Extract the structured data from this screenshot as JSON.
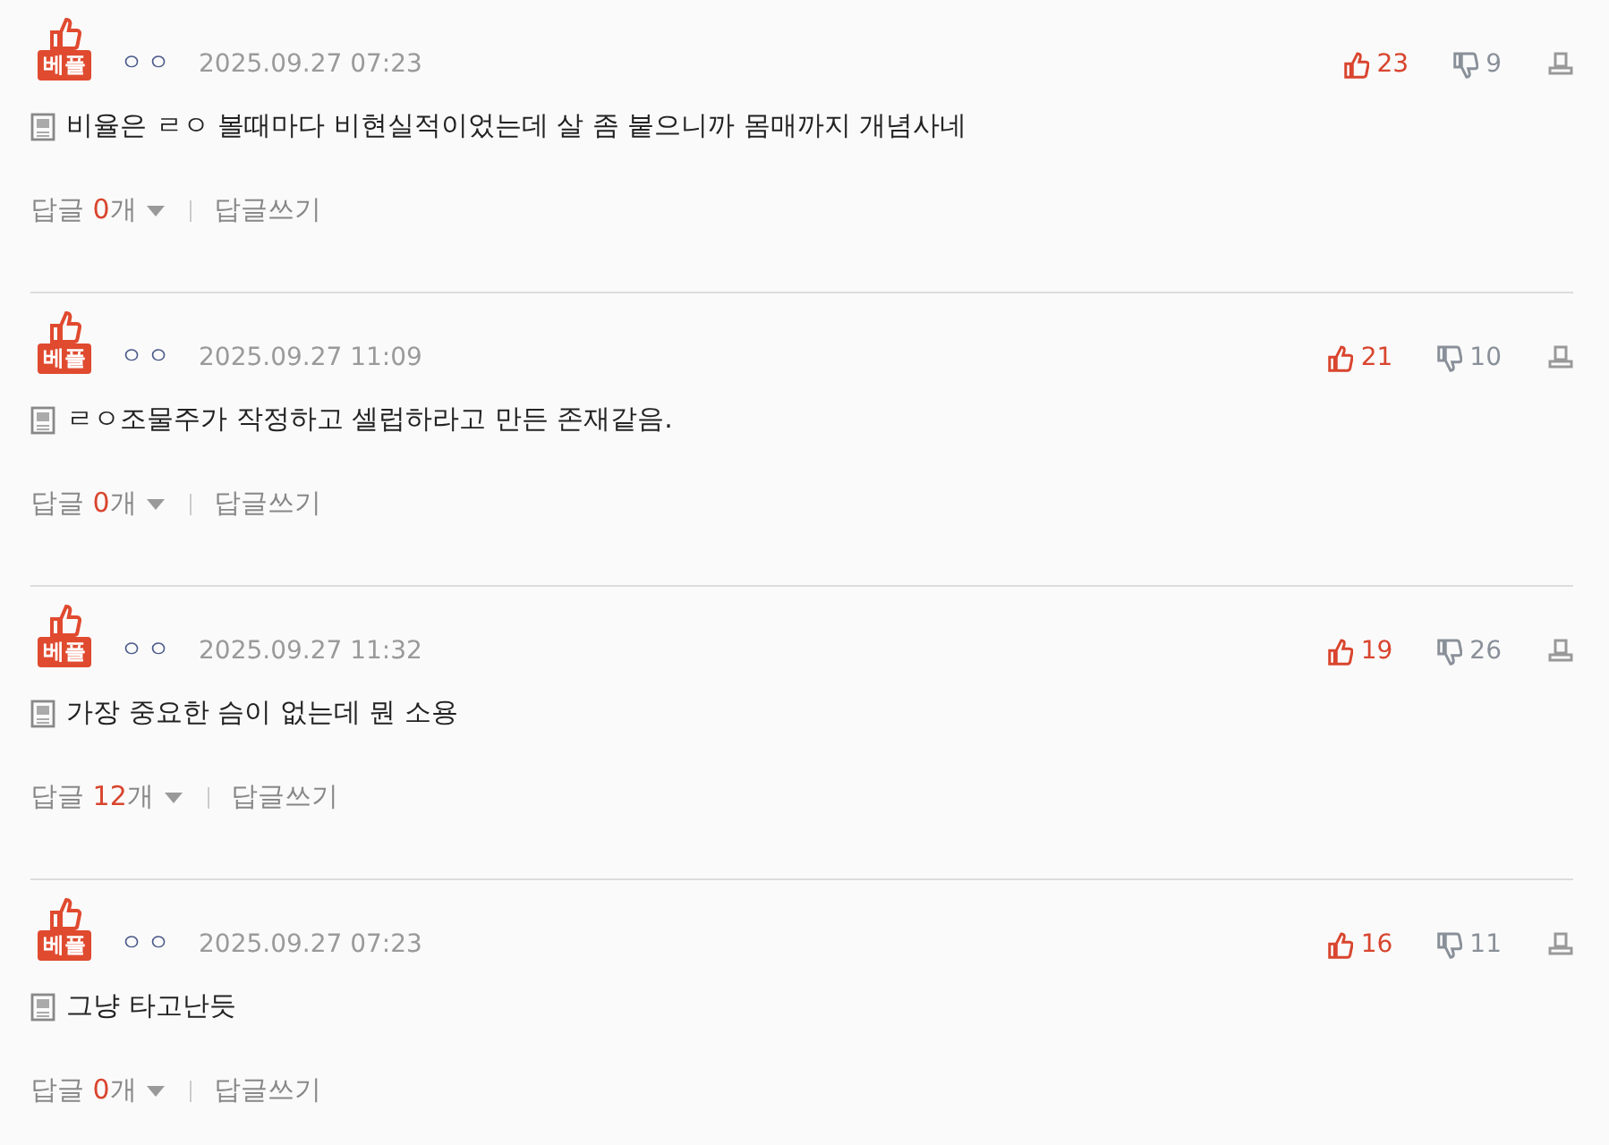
{
  "comments": [
    {
      "badge": "베플",
      "author": "ㅇㅇ",
      "date": "2025.09.27 07:23",
      "likes": "23",
      "dislikes": "9",
      "text": "비율은 ㄹㅇ 볼때마다 비현실적이었는데 살 좀 붙으니까 몸매까지 개념사네",
      "reply_label": "답글",
      "reply_count": "0",
      "reply_unit": "개",
      "write_reply": "답글쓰기"
    },
    {
      "badge": "베플",
      "author": "ㅇㅇ",
      "date": "2025.09.27 11:09",
      "likes": "21",
      "dislikes": "10",
      "text": "ㄹㅇ조물주가 작정하고 셀럽하라고 만든 존재같음.",
      "reply_label": "답글",
      "reply_count": "0",
      "reply_unit": "개",
      "write_reply": "답글쓰기"
    },
    {
      "badge": "베플",
      "author": "ㅇㅇ",
      "date": "2025.09.27 11:32",
      "likes": "19",
      "dislikes": "26",
      "text": "가장 중요한 슴이 없는데 뭔 소용",
      "reply_label": "답글",
      "reply_count": "12",
      "reply_unit": "개",
      "write_reply": "답글쓰기"
    },
    {
      "badge": "베플",
      "author": "ㅇㅇ",
      "date": "2025.09.27 07:23",
      "likes": "16",
      "dislikes": "11",
      "text": "그냥 타고난듯",
      "reply_label": "답글",
      "reply_count": "0",
      "reply_unit": "개",
      "write_reply": "답글쓰기"
    }
  ]
}
